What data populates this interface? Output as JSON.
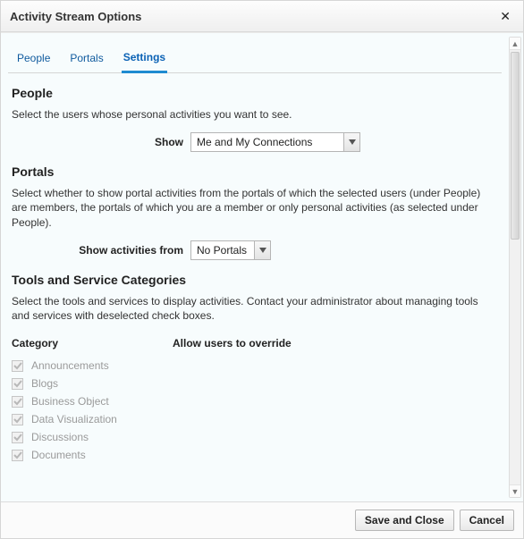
{
  "dialog": {
    "title": "Activity Stream Options"
  },
  "tabs": {
    "people": "People",
    "portals": "Portals",
    "settings": "Settings",
    "active": "settings"
  },
  "sections": {
    "people": {
      "title": "People",
      "desc": "Select the users whose personal activities you want to see.",
      "show_label": "Show",
      "show_value": "Me and My Connections"
    },
    "portals": {
      "title": "Portals",
      "desc": "Select whether to show portal activities from the portals of which the selected users (under People) are members, the portals of which you are a member or only personal activities (as selected under People).",
      "from_label": "Show activities from",
      "from_value": "No Portals"
    },
    "tools": {
      "title": "Tools and Service Categories",
      "desc": "Select the tools and services to display activities. Contact your administrator about managing tools and services with deselected check boxes.",
      "col_category": "Category",
      "col_override": "Allow users to override",
      "items": [
        {
          "label": "Announcements",
          "checked": true,
          "disabled": true
        },
        {
          "label": "Blogs",
          "checked": true,
          "disabled": true
        },
        {
          "label": "Business Object",
          "checked": true,
          "disabled": true
        },
        {
          "label": "Data Visualization",
          "checked": true,
          "disabled": true
        },
        {
          "label": "Discussions",
          "checked": true,
          "disabled": true
        },
        {
          "label": "Documents",
          "checked": true,
          "disabled": true
        }
      ]
    }
  },
  "footer": {
    "save": "Save and Close",
    "cancel": "Cancel"
  }
}
